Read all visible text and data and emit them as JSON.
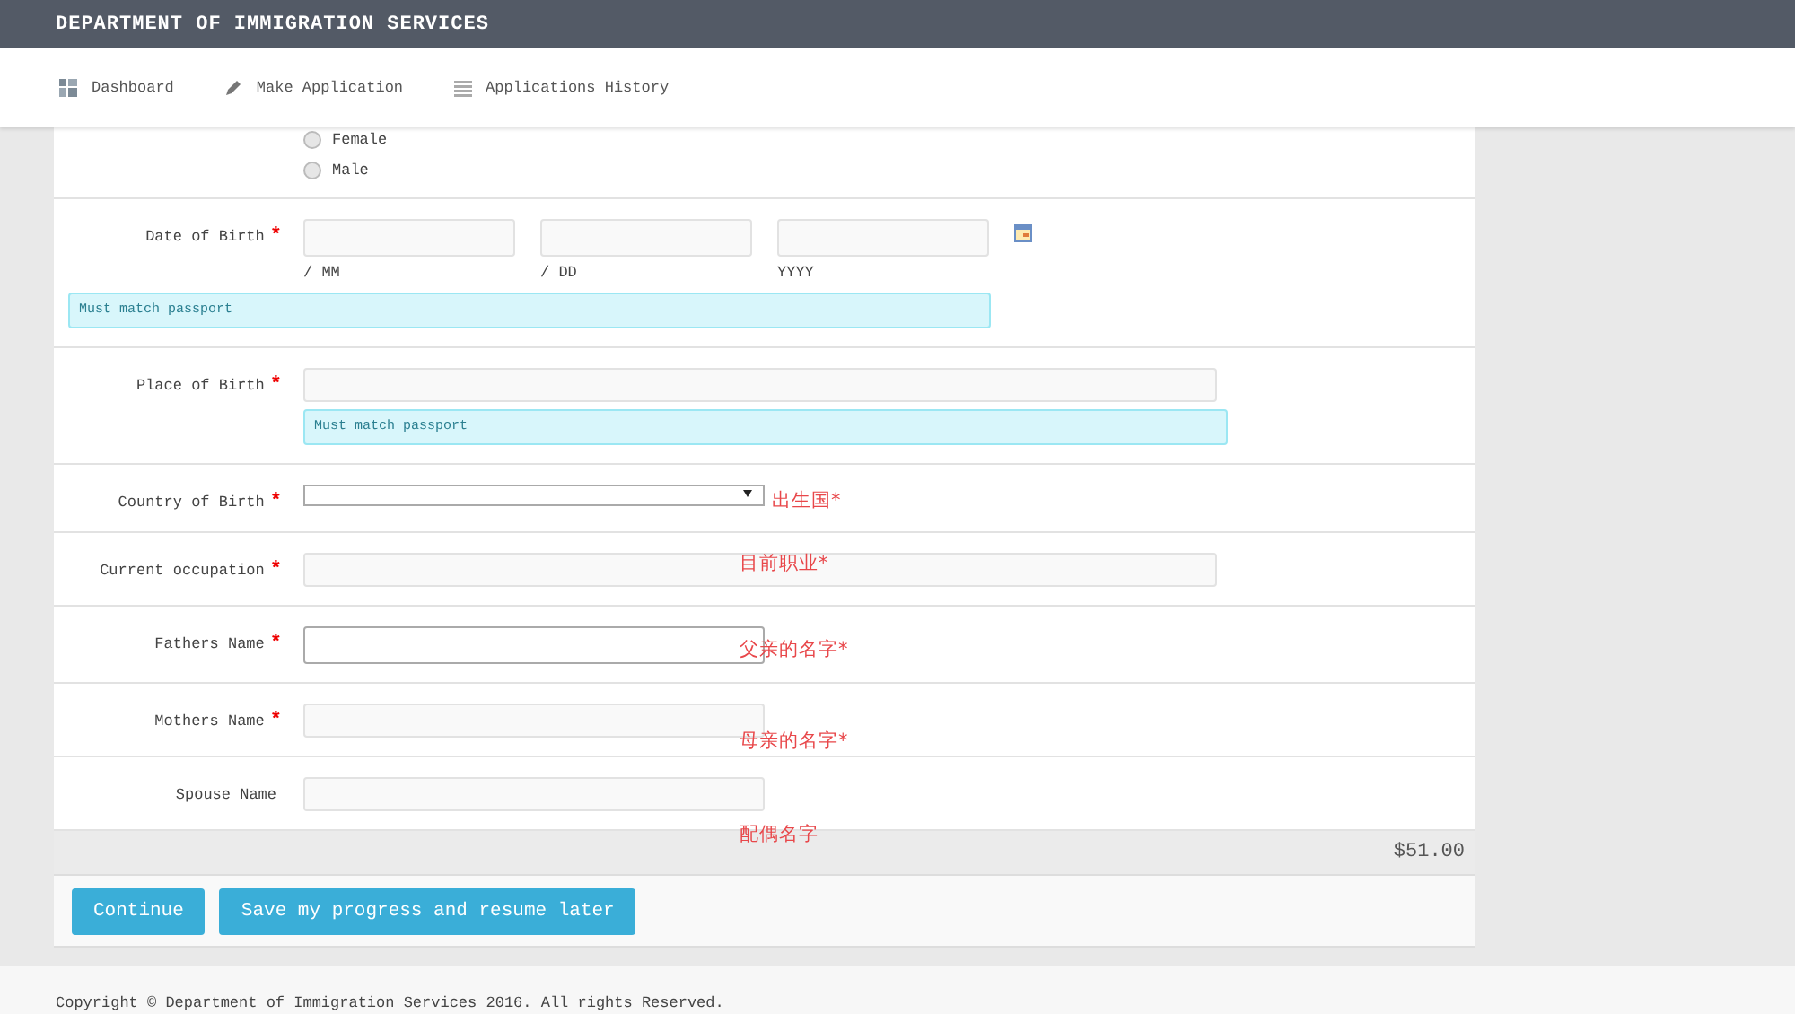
{
  "header": {
    "title": "DEPARTMENT OF IMMIGRATION SERVICES"
  },
  "nav": [
    {
      "label": "Dashboard"
    },
    {
      "label": "Make Application"
    },
    {
      "label": "Applications History"
    }
  ],
  "form": {
    "rows": [
      {
        "kind": "radio",
        "options": [
          {
            "label": "Female",
            "selected": false
          },
          {
            "label": "Male",
            "selected": false
          }
        ]
      },
      {
        "kind": "date",
        "label": "Date of Birth",
        "mark": "*",
        "parts": [
          "/ MM",
          "/ DD",
          "YYYY"
        ],
        "help": "Must match passport"
      },
      {
        "kind": "longtext",
        "label": "Place of Birth",
        "mark": "*",
        "focused": false,
        "help": "Must match passport"
      },
      {
        "kind": "select",
        "label": "Country of Birth",
        "mark": "*",
        "note": "出生国*"
      },
      {
        "kind": "longtext",
        "label": "Current occupation",
        "mark": "*",
        "focused": false,
        "note": "目前职业*"
      },
      {
        "kind": "text",
        "label": "Fathers Name",
        "mark": "*",
        "focused": true,
        "note": "父亲的名字*"
      },
      {
        "kind": "text",
        "label": "Mothers Name",
        "mark": "*",
        "focused": false,
        "note": "母亲的名字*"
      },
      {
        "kind": "text",
        "label": "Spouse Name",
        "focused": false,
        "note": "配偶名字"
      }
    ],
    "total": "$51.00",
    "buttons": [
      "Continue",
      "Save my progress and resume later"
    ]
  },
  "footer": "Copyright © Department of Immigration Services 2016. All rights Reserved."
}
